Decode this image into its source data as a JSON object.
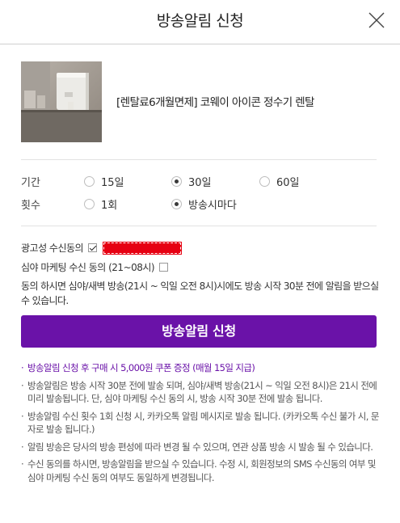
{
  "header": {
    "title": "방송알림 신청"
  },
  "product": {
    "name": "[렌탈료6개월면제] 코웨이 아이콘 정수기 렌탈"
  },
  "options": {
    "period": {
      "label": "기간",
      "choices": [
        {
          "label": "15일",
          "selected": false
        },
        {
          "label": "30일",
          "selected": true
        },
        {
          "label": "60일",
          "selected": false
        }
      ]
    },
    "count": {
      "label": "횟수",
      "choices": [
        {
          "label": "1회",
          "selected": false
        },
        {
          "label": "방송시마다",
          "selected": true
        }
      ]
    }
  },
  "consent": {
    "ad_label": "광고성 수신동의",
    "ad_checked": true,
    "night_label": "심야 마케팅 수신 동의 (21~08시)",
    "night_checked": false,
    "description": "동의 하시면 심야/새벽 방송(21시 ~ 익일 오전 8시)시에도 방송 시작 30분 전에 알림을 받으실 수 있습니다."
  },
  "submit_label": "방송알림 신청",
  "notes": [
    "방송알림 신청 후 구매 시 5,000원 쿠폰 증정 (매월 15일 지급)",
    "방송알림은 방송 시작 30분 전에 발송 되며, 심야/새벽 방송(21시 ~ 익일 오전 8시)은 21시 전에 미리 발송됩니다. 단, 심야 마케팅 수신 동의 시, 방송 시작 30분 전에 발송 됩니다.",
    "방송알림 수신 횟수 1회 신청 시, 카카오톡 알림 메시지로 발송 됩니다. (카카오톡 수신 불가 시, 문자로 발송 됩니다.)",
    "알림 방송은 당사의 방송 편성에 따라 변경 될 수 있으며, 연관 상품 방송 시 발송 될 수 있습니다.",
    "수신 동의를 하시면, 방송알림을 받으실 수 있습니다. 수정 시, 회원정보의 SMS 수신동의 여부 및 심야 마케팅 수신 동의 여부도 동일하게 변경됩니다."
  ],
  "colors": {
    "accent": "#6a12a8",
    "redaction": "#e60012"
  }
}
